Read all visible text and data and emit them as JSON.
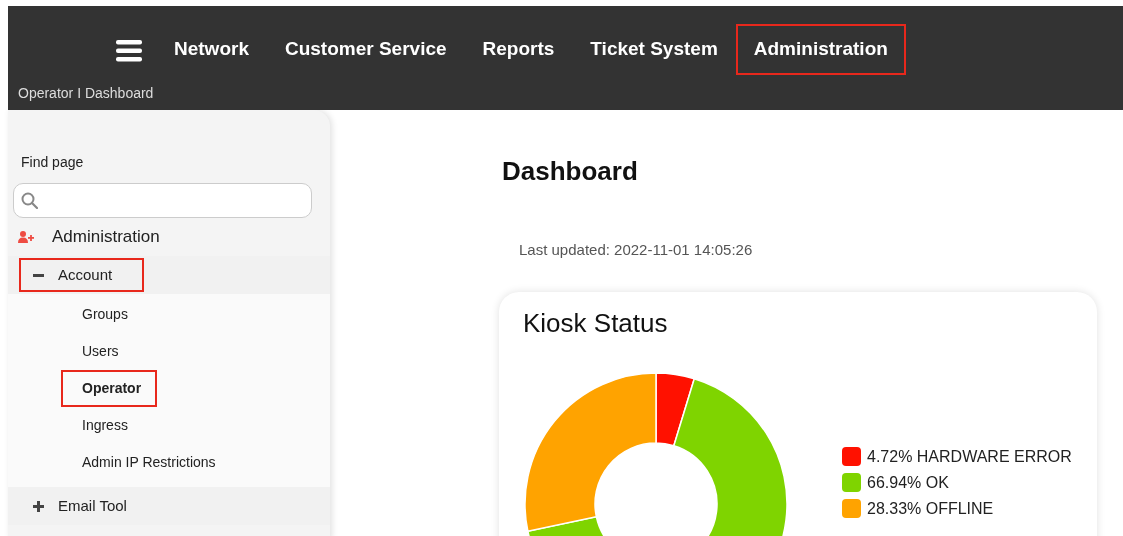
{
  "nav": {
    "items": [
      {
        "label": "Network",
        "highlighted": false
      },
      {
        "label": "Customer Service",
        "highlighted": false
      },
      {
        "label": "Reports",
        "highlighted": false
      },
      {
        "label": "Ticket System",
        "highlighted": false
      },
      {
        "label": "Administration",
        "highlighted": true
      }
    ]
  },
  "breadcrumb": "Operator I Dashboard",
  "sidebar": {
    "search_label": "Find page",
    "section": {
      "label": "Administration",
      "groups": [
        {
          "label": "Account",
          "expanded": true,
          "highlighted": true,
          "children": [
            {
              "label": "Groups",
              "selected": false,
              "highlighted": false
            },
            {
              "label": "Users",
              "selected": false,
              "highlighted": false
            },
            {
              "label": "Operator",
              "selected": true,
              "highlighted": true
            },
            {
              "label": "Ingress",
              "selected": false,
              "highlighted": false
            },
            {
              "label": "Admin IP Restrictions",
              "selected": false,
              "highlighted": false
            }
          ]
        },
        {
          "label": "Email Tool",
          "expanded": false,
          "highlighted": false
        }
      ]
    }
  },
  "main": {
    "title": "Dashboard",
    "last_updated": "Last updated: 2022-11-01 14:05:26",
    "card": {
      "title": "Kiosk Status",
      "chart_data": {
        "type": "donut",
        "categories": [
          "4.72% HARDWARE ERROR",
          "66.94% OK",
          "28.33% OFFLINE"
        ],
        "values": [
          4.72,
          66.94,
          28.33
        ],
        "colors": [
          "#ff1100",
          "#7fd400",
          "#ffa300"
        ]
      }
    }
  }
}
